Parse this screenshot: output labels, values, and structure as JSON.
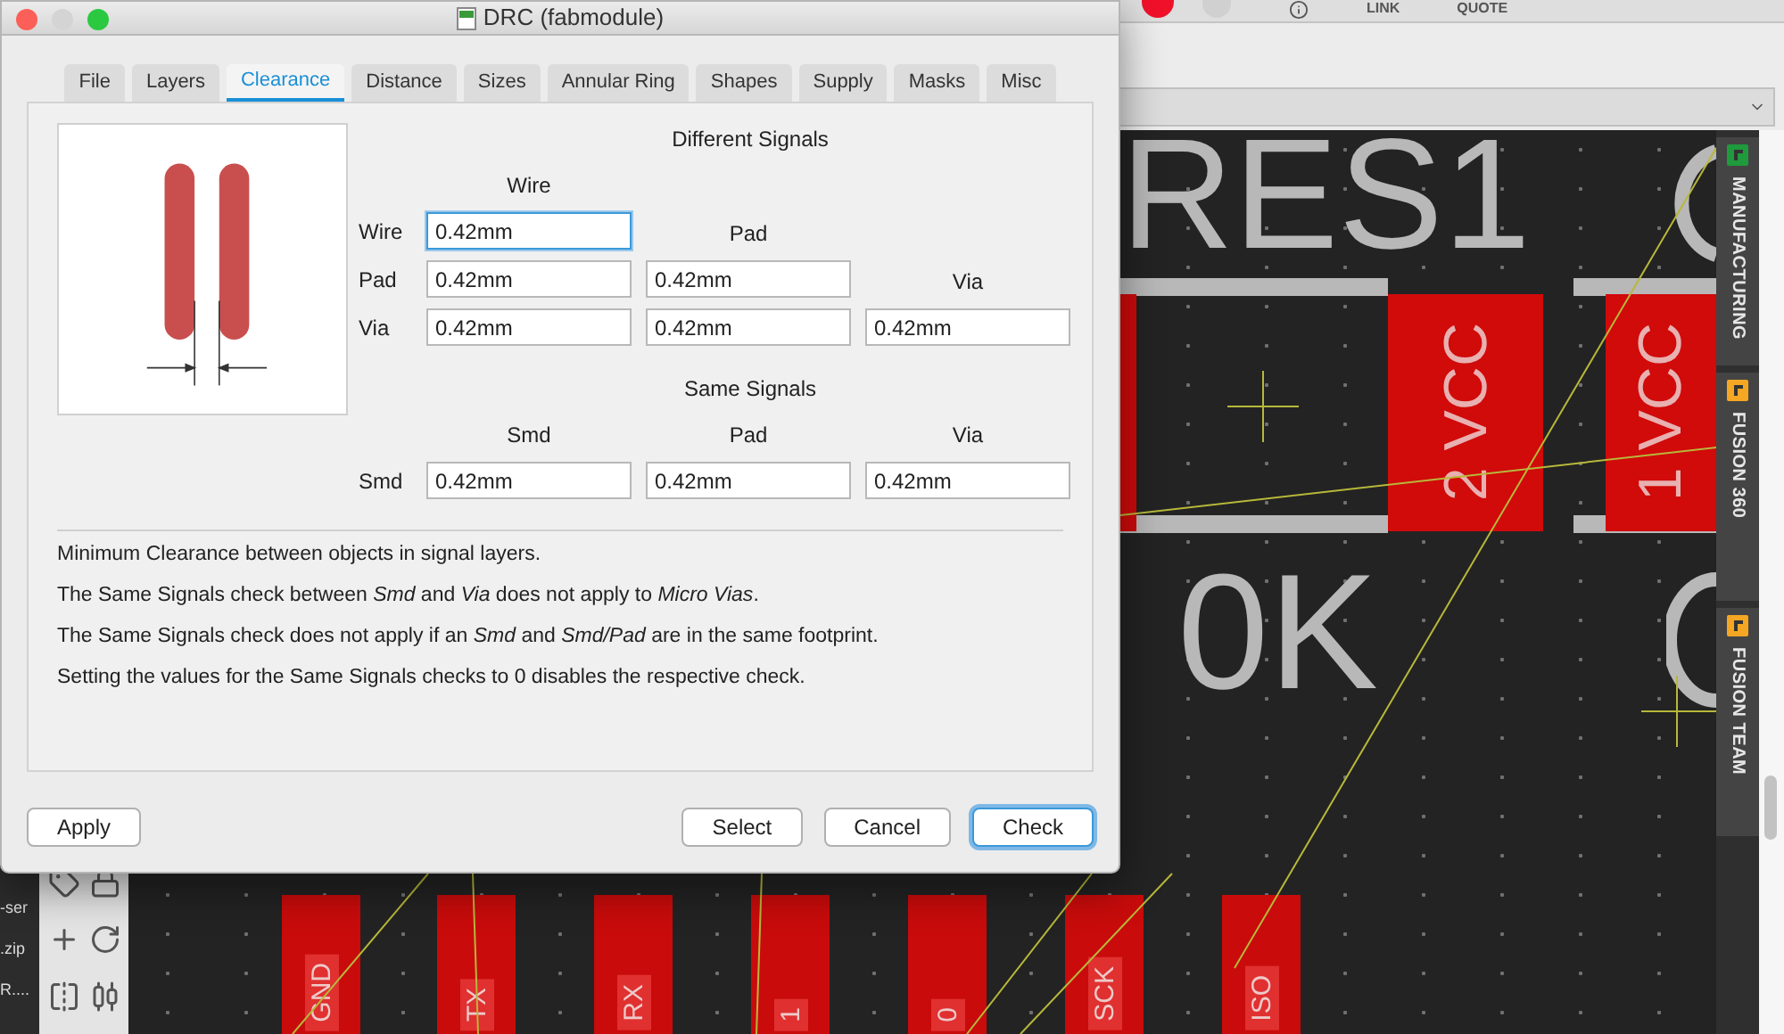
{
  "app": {
    "toolbar": [
      {
        "label": "LINK"
      },
      {
        "label": "QUOTE"
      }
    ],
    "left_panel": {
      "texts": [
        "-ser",
        ".zip",
        "R...."
      ]
    },
    "pcb": {
      "texts": [
        "RES1",
        "0K"
      ],
      "pads": [
        "2 VCC",
        "1 VCC"
      ],
      "bottom_pads": [
        "GND",
        "TX",
        "RX",
        "1",
        "0",
        "SCK",
        "ISO"
      ]
    },
    "side_tabs": [
      {
        "label": "MANUFACTURING",
        "color": "#1f9a3c"
      },
      {
        "label": "FUSION 360",
        "color": "#f5a623"
      },
      {
        "label": "FUSION TEAM",
        "color": "#f5a623"
      }
    ]
  },
  "dialog": {
    "title": "DRC (fabmodule)",
    "tabs": [
      {
        "label": "File",
        "selected": false
      },
      {
        "label": "Layers",
        "selected": false
      },
      {
        "label": "Clearance",
        "selected": true
      },
      {
        "label": "Distance",
        "selected": false
      },
      {
        "label": "Sizes",
        "selected": false
      },
      {
        "label": "Annular Ring",
        "selected": false
      },
      {
        "label": "Shapes",
        "selected": false
      },
      {
        "label": "Supply",
        "selected": false
      },
      {
        "label": "Masks",
        "selected": false
      },
      {
        "label": "Misc",
        "selected": false
      }
    ],
    "different_signals": {
      "heading": "Different Signals",
      "column_headers": [
        "Wire",
        "Pad",
        "Via"
      ],
      "rows": [
        {
          "label": "Wire",
          "values": [
            {
              "value": "0.42mm",
              "focused": true
            }
          ]
        },
        {
          "label": "Pad",
          "values": [
            {
              "value": "0.42mm",
              "focused": false
            },
            {
              "value": "0.42mm",
              "focused": false
            }
          ]
        },
        {
          "label": "Via",
          "values": [
            {
              "value": "0.42mm",
              "focused": false
            },
            {
              "value": "0.42mm",
              "focused": false
            },
            {
              "value": "0.42mm",
              "focused": false
            }
          ]
        }
      ]
    },
    "same_signals": {
      "heading": "Same Signals",
      "column_headers": [
        "Smd",
        "Pad",
        "Via"
      ],
      "rows": [
        {
          "label": "Smd",
          "values": [
            {
              "value": "0.42mm",
              "focused": false
            },
            {
              "value": "0.42mm",
              "focused": false
            },
            {
              "value": "0.42mm",
              "focused": false
            }
          ]
        }
      ]
    },
    "notes": [
      "Minimum Clearance between objects in signal layers.",
      "The Same Signals check between *Smd* and *Via* does not apply to *Micro Vias*.",
      "The Same Signals check does not apply if an *Smd* and *Smd/Pad* are in the same footprint.",
      "Setting the values for the Same Signals checks to 0 disables the respective check."
    ],
    "left_buttons": [
      {
        "label": "Apply",
        "default": false
      }
    ],
    "right_buttons": [
      {
        "label": "Select",
        "default": false
      },
      {
        "label": "Cancel",
        "default": false
      },
      {
        "label": "Check",
        "default": true
      }
    ]
  }
}
